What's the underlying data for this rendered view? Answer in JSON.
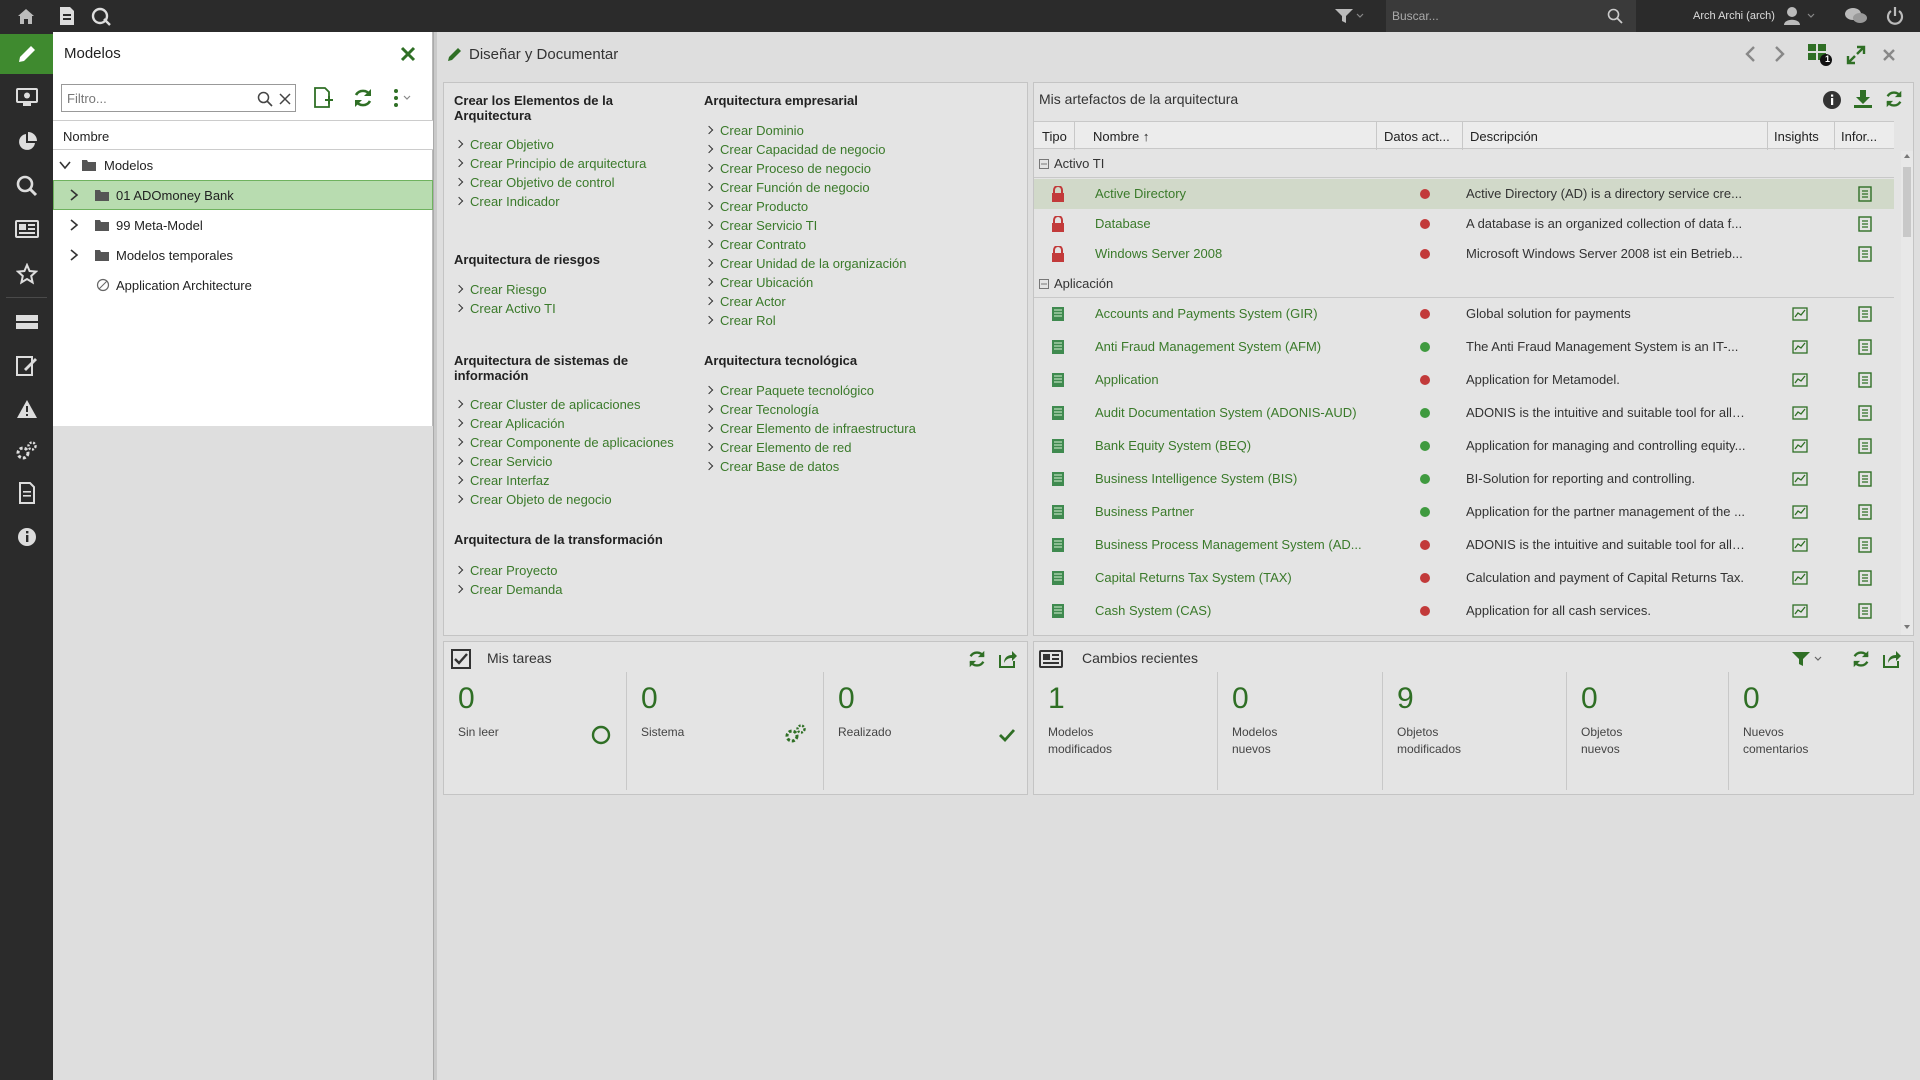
{
  "topbar": {
    "search_placeholder": "Buscar...",
    "user_name": "Arch Archi (arch)",
    "icons": [
      "home-icon",
      "new-document-icon",
      "refresh-globe-icon",
      "filter-icon",
      "search-icon",
      "user-icon",
      "chat-icon",
      "power-icon"
    ]
  },
  "left_rail": {
    "items": [
      "design-document-icon",
      "monitor-icon",
      "pie-chart-icon",
      "search-icon",
      "newspaper-icon",
      "star-icon",
      "layers-icon",
      "sign-icon",
      "warning-icon",
      "gears-icon",
      "document-icon",
      "info-icon"
    ],
    "active": "design-document-icon",
    "accent": "#3f8a2f"
  },
  "models_panel": {
    "title": "Modelos",
    "filter_placeholder": "Filtro...",
    "column_header": "Nombre",
    "tree": [
      {
        "label": "Modelos",
        "level": 0,
        "expanded": true,
        "type": "folder"
      },
      {
        "label": "01 ADOmoney Bank",
        "level": 1,
        "expanded": false,
        "type": "folder",
        "selected": true
      },
      {
        "label": "99 Meta-Model",
        "level": 1,
        "expanded": false,
        "type": "folder"
      },
      {
        "label": "Modelos temporales",
        "level": 1,
        "expanded": false,
        "type": "folder"
      },
      {
        "label": "Application Architecture",
        "level": 1,
        "type": "model"
      }
    ]
  },
  "main": {
    "title": "Diseñar y Documentar",
    "badge": "1"
  },
  "create_card": {
    "left_column": [
      {
        "title": "Crear los Elementos de la Arquitectura",
        "links": [
          "Crear Objetivo",
          "Crear Principio de arquitectura",
          "Crear Objetivo de control",
          "Crear Indicador"
        ]
      },
      {
        "title": "Arquitectura de riesgos",
        "links": [
          "Crear Riesgo",
          "Crear Activo TI"
        ]
      },
      {
        "title": "Arquitectura de sistemas de información",
        "links": [
          "Crear Cluster de aplicaciones",
          "Crear Aplicación",
          "Crear Componente de aplicaciones",
          "Crear Servicio",
          "Crear Interfaz",
          "Crear Objeto de negocio"
        ]
      },
      {
        "title": "Arquitectura de la transformación",
        "links": [
          "Crear Proyecto",
          "Crear Demanda"
        ]
      }
    ],
    "right_column": [
      {
        "title": "Arquitectura empresarial",
        "links": [
          "Crear Dominio",
          "Crear Capacidad de negocio",
          "Crear Proceso de negocio",
          "Crear Función de negocio",
          "Crear Producto",
          "Crear Servicio TI",
          "Crear Contrato",
          "Crear Unidad de la organización",
          "Crear Ubicación",
          "Crear Actor",
          "Crear Rol"
        ]
      },
      {
        "title": "Arquitectura tecnológica",
        "links": [
          "Crear Paquete tecnológico",
          "Crear Tecnología",
          "Crear Elemento de infraestructura",
          "Crear Elemento de red",
          "Crear Base de datos"
        ]
      }
    ]
  },
  "artifacts": {
    "title": "Mis artefactos de la arquitectura",
    "columns": [
      "Tipo",
      "Nombre ↑",
      "Datos act...",
      "Descripción",
      "Insights",
      "Infor..."
    ],
    "groups": [
      {
        "name": "Activo TI",
        "rows": [
          {
            "name": "Active Directory",
            "status": "no",
            "desc": "Active Directory (AD) is a directory service cre...",
            "highlight": true
          },
          {
            "name": "Database",
            "status": "no",
            "desc": "A database is an organized collection of data f..."
          },
          {
            "name": "Windows Server 2008",
            "status": "no",
            "desc": "Microsoft Windows Server 2008 ist ein Betrieb..."
          }
        ]
      },
      {
        "name": "Aplicación",
        "rows": [
          {
            "name": "Accounts and Payments System (GIR)",
            "status": "no",
            "desc": "Global solution for payments"
          },
          {
            "name": "Anti Fraud Management System (AFM)",
            "status": "ok",
            "desc": "The Anti Fraud Management System is an IT-..."
          },
          {
            "name": "Application",
            "status": "no",
            "desc": "Application for Metamodel."
          },
          {
            "name": "Audit Documentation System (ADONIS-AUD)",
            "status": "ok",
            "desc": "ADONIS is the intuitive and suitable tool for all ..."
          },
          {
            "name": "Bank Equity System (BEQ)",
            "status": "ok",
            "desc": "Application for managing and controlling equity..."
          },
          {
            "name": "Business Intelligence System (BIS)",
            "status": "ok",
            "desc": "BI-Solution for reporting and controlling."
          },
          {
            "name": "Business Partner",
            "status": "ok",
            "desc": "Application for the partner management of the ..."
          },
          {
            "name": "Business Process Management System (AD...",
            "status": "no",
            "desc": "ADONIS is the intuitive and suitable tool for all ..."
          },
          {
            "name": "Capital Returns Tax System (TAX)",
            "status": "no",
            "desc": "Calculation and payment of Capital Returns Tax."
          },
          {
            "name": "Cash System (CAS)",
            "status": "no",
            "desc": "Application for all cash services."
          }
        ]
      }
    ]
  },
  "tasks": {
    "title": "Mis tareas",
    "tiles": [
      {
        "value": "0",
        "label": "Sin leer",
        "icon": "circle-icon"
      },
      {
        "value": "0",
        "label": "Sistema",
        "icon": "gears-icon"
      },
      {
        "value": "0",
        "label": "Realizado",
        "icon": "check-icon"
      }
    ]
  },
  "changes": {
    "title": "Cambios recientes",
    "tiles": [
      {
        "value": "1",
        "label": "Modelos\nmodificados"
      },
      {
        "value": "0",
        "label": "Modelos\nnuevos"
      },
      {
        "value": "9",
        "label": "Objetos\nmodificados"
      },
      {
        "value": "0",
        "label": "Objetos\nnuevos"
      },
      {
        "value": "0",
        "label": "Nuevos\ncomentarios"
      }
    ]
  }
}
